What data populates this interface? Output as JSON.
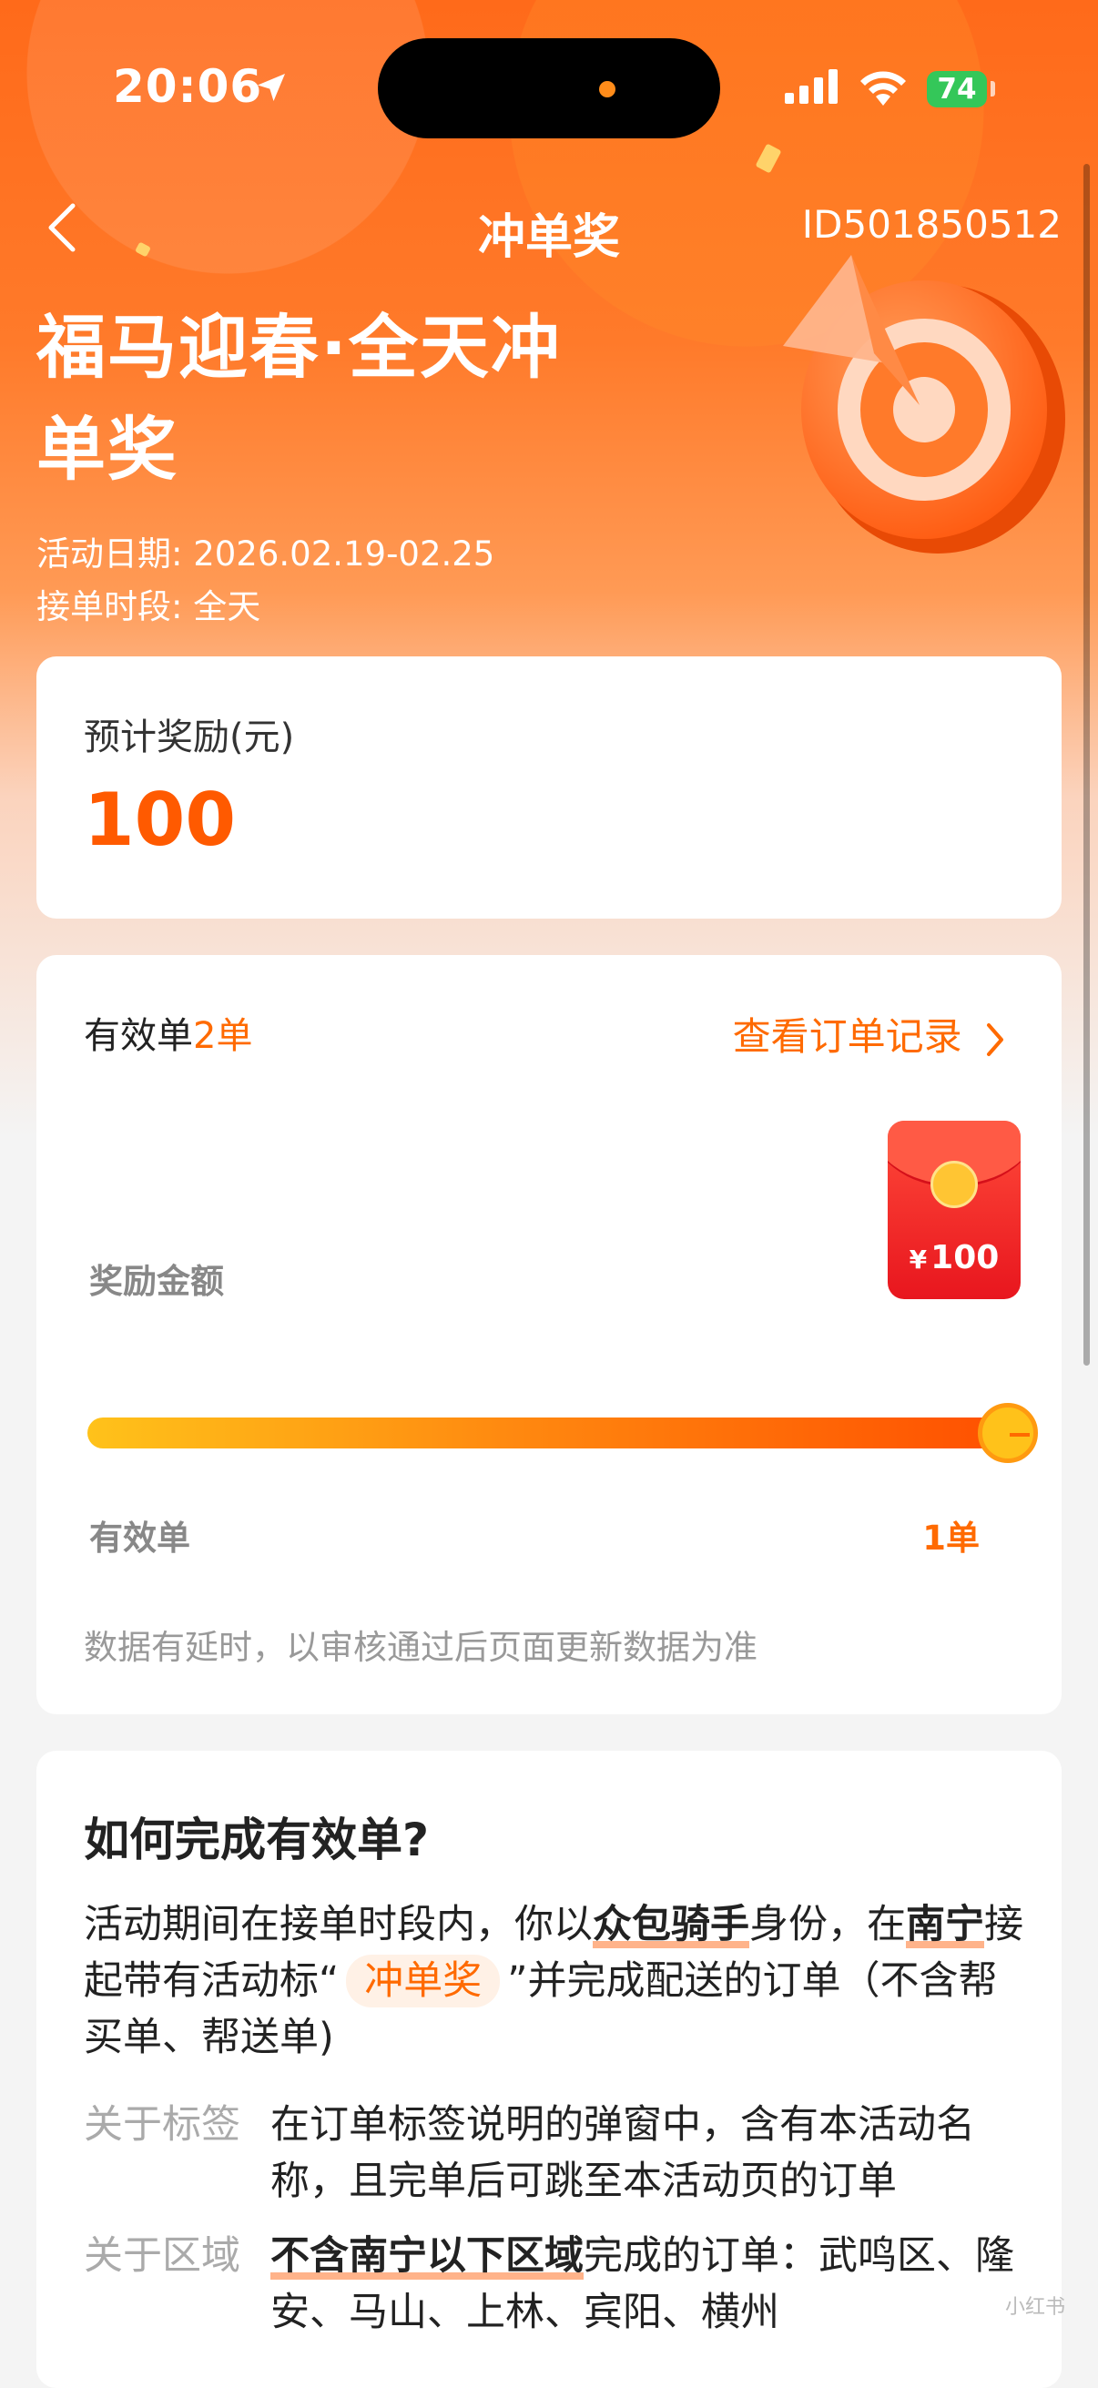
{
  "status_bar": {
    "time": "20:06",
    "battery": "74"
  },
  "nav": {
    "title": "冲单奖",
    "id": "ID501850512"
  },
  "hero": {
    "title": "福马迎春·全天冲单奖",
    "date_line": "活动日期: 2026.02.19-02.25",
    "time_line": "接单时段: 全天"
  },
  "reward": {
    "label": "预计奖励(元)",
    "value": "100"
  },
  "progress": {
    "valid_prefix": "有效单",
    "valid_count": "2单",
    "orders_link": "查看订单记录",
    "reward_amount_label": "奖励金额",
    "redpacket_currency": "¥",
    "redpacket_amount": "100",
    "fill_fraction": 1.0,
    "axis_left": "有效单",
    "axis_right": "1单",
    "note": "数据有延时，以审核通过后页面更新数据为准"
  },
  "howto": {
    "title": "如何完成有效单?",
    "p1_a": "活动期间在接单时段内，你以",
    "p1_b": "众包骑手",
    "p1_c": "身份，在",
    "p1_d": "南宁",
    "p1_e": "接起带有活动标“",
    "p1_tag": "冲单奖",
    "p1_f": "”并完成配送的订单（不含帮买单、帮送单)",
    "rules": [
      {
        "key": "关于标签",
        "value": "在订单标签说明的弹窗中，含有本活动名称，且完单后可跳至本活动页的订单"
      },
      {
        "key": "关于区域",
        "value_bold": "不含南宁以下区域",
        "value": "完成的订单：武鸣区、隆安、马山、上林、宾阳、横州"
      }
    ]
  },
  "watermark": "小红书"
}
